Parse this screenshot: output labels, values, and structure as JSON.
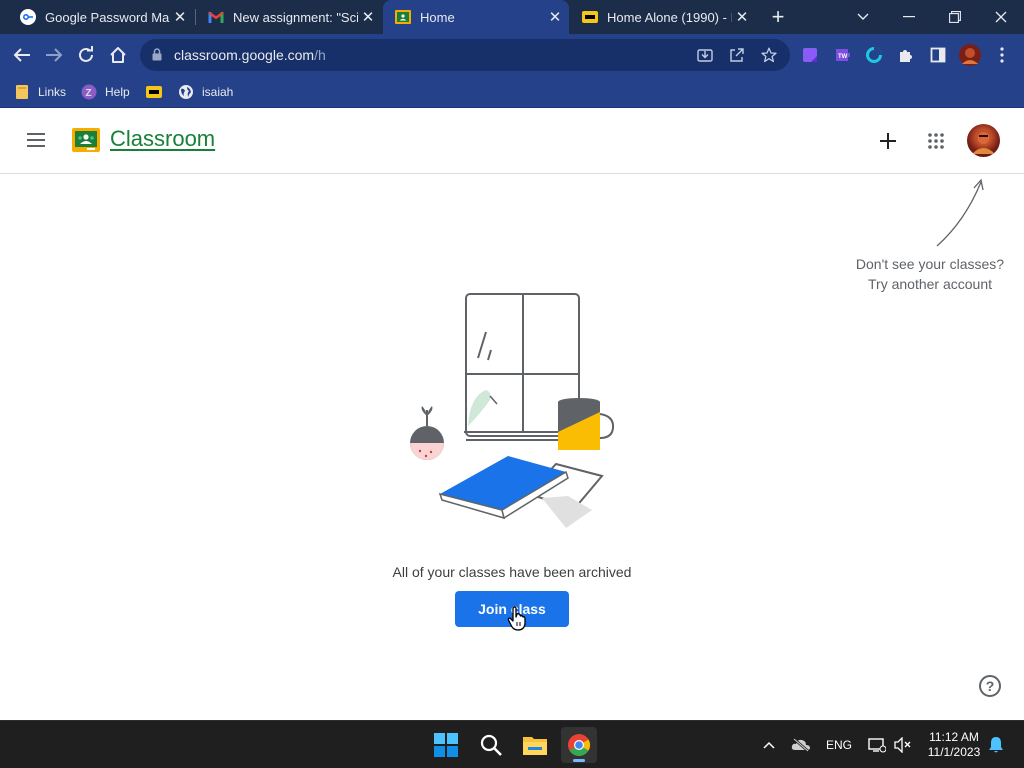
{
  "browser": {
    "tabs": [
      {
        "title": "Google Password Man",
        "favicon": "google-password-manager-icon",
        "active": false
      },
      {
        "title": "New assignment: \"Scie",
        "favicon": "gmail-icon",
        "active": false
      },
      {
        "title": "Home",
        "favicon": "classroom-icon",
        "active": true
      },
      {
        "title": "Home Alone (1990) - I",
        "favicon": "imdb-icon",
        "active": false
      }
    ],
    "url_host": "classroom.google.com",
    "url_path": "/h",
    "bookmarks": [
      {
        "label": "Links",
        "icon": "folder-icon"
      },
      {
        "label": "Help",
        "icon": "help-bookmark-icon"
      },
      {
        "label": "",
        "icon": "imdb-icon"
      },
      {
        "label": "isaiah",
        "icon": "globe-icon"
      }
    ]
  },
  "app": {
    "title": "Classroom",
    "hint_line1": "Don't see your classes?",
    "hint_line2": "Try another account",
    "empty_message": "All of your classes have been archived",
    "join_button": "Join class",
    "help_label": "?"
  },
  "taskbar": {
    "language": "ENG",
    "time": "11:12 AM",
    "date": "11/1/2023"
  },
  "colors": {
    "tabstrip": "#1c2d4a",
    "toolbar": "#24418a",
    "classroom_green": "#188038",
    "primary_blue": "#1a73e8",
    "taskbar": "#1f1f1f"
  }
}
